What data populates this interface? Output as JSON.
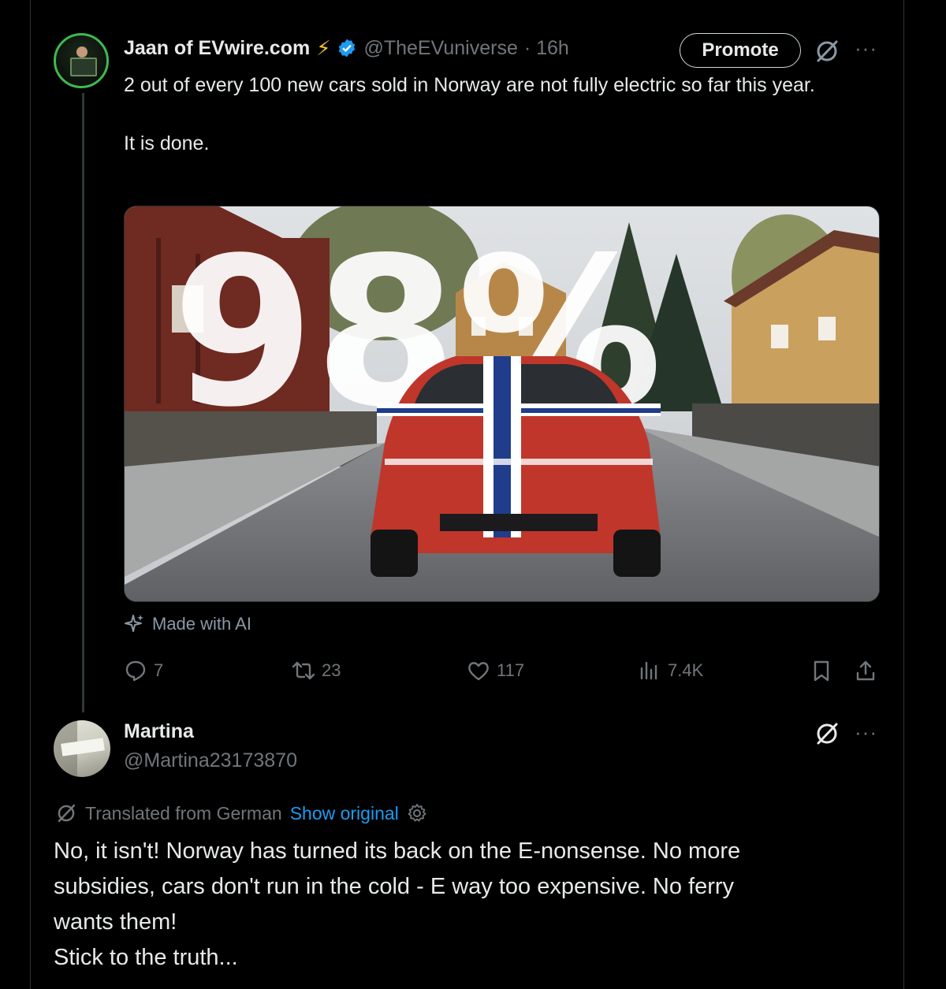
{
  "tweet": {
    "author_name": "Jaan of EVwire.com",
    "author_handle": "@TheEVuniverse",
    "time": "· 16h",
    "promote_label": "Promote",
    "more_label": "···",
    "text_line1": "2 out of every 100 new cars sold in Norway are not fully electric so far this year.",
    "text_line2": "It is done.",
    "media_overlay_text": "98%",
    "ai_label": "Made with AI",
    "stats": {
      "replies": "7",
      "reposts": "23",
      "likes": "117",
      "views": "7.4K"
    }
  },
  "reply": {
    "author_name": "Martina",
    "author_handle": "@Martina23173870",
    "more_label": "···",
    "translated_label": "Translated from German",
    "show_original_label": "Show original",
    "text_lines": [
      "No, it isn't! Norway has turned its back on the E-nonsense. No more",
      "subsidies, cars don't run in the cold - E way too expensive. No ferry",
      "wants them!",
      "Stick to the truth..."
    ]
  },
  "colors": {
    "background": "#000000",
    "text": "#e7e9ea",
    "muted": "#71767b",
    "link": "#1d9bf0",
    "verified": "#1d9bf0",
    "bolt": "#f4c430",
    "avatar_ring": "#3fb950"
  },
  "icons": [
    "bolt-icon",
    "verified-badge-icon",
    "grok-icon",
    "more-icon",
    "sparkle-icon",
    "reply-icon",
    "repost-icon",
    "like-icon",
    "views-icon",
    "bookmark-icon",
    "share-icon",
    "translate-icon",
    "settings-icon"
  ]
}
